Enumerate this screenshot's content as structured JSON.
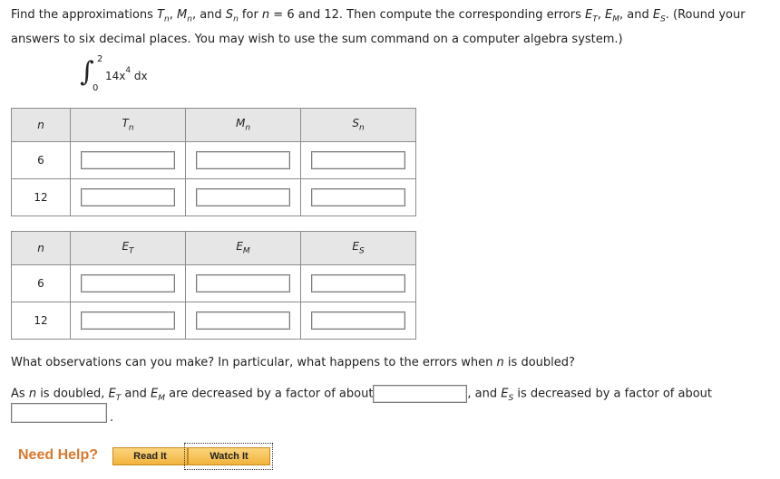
{
  "question": {
    "p1": "Find the approximations ",
    "T": "T",
    "n": "n",
    "sep1": ", ",
    "M": "M",
    "sep2": ", and ",
    "S": "S",
    "p2": " for ",
    "p3": " = 6 and 12. Then compute the corresponding errors ",
    "E": "E",
    "subT": "T",
    "subM": "M",
    "subS": "S",
    "p4": ". (Round your answers to six decimal places. You may wish to use the sum command on a computer algebra system.)"
  },
  "integral": {
    "sign": "∫",
    "upper": "2",
    "lower": "0",
    "coef": "14x",
    "exp": "4",
    "dx": " dx"
  },
  "table1": {
    "headers": [
      "n",
      "T",
      "M",
      "S"
    ],
    "sub": "n",
    "rows": [
      "6",
      "12"
    ]
  },
  "table2": {
    "headers": [
      "n",
      "E",
      "E",
      "E"
    ],
    "subs": [
      "T",
      "M",
      "S"
    ],
    "rows": [
      "6",
      "12"
    ]
  },
  "observation": {
    "text1": "What observations can you make? In particular, what happens to the errors when ",
    "n": "n",
    "text2": " is doubled?",
    "l1": "As ",
    "l2": " is doubled, ",
    "E": "E",
    "l3": " and ",
    "l4": " are decreased by a factor of about",
    "l5": ", and ",
    "l6": " is decreased by a factor of about",
    "end": "."
  },
  "help": {
    "label": "Need Help?",
    "read": "Read It",
    "watch": "Watch It"
  }
}
